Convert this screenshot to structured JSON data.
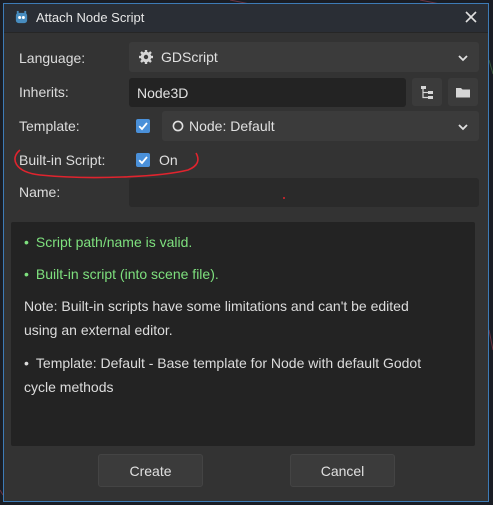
{
  "window": {
    "title": "Attach Node Script"
  },
  "form": {
    "language_label": "Language:",
    "language_value": "GDScript",
    "inherits_label": "Inherits:",
    "inherits_value": "Node3D",
    "template_label": "Template:",
    "template_value": "Node: Default",
    "builtin_label": "Built-in Script:",
    "builtin_value": "On",
    "name_label": "Name:",
    "name_value": ""
  },
  "info": {
    "line1": "Script path/name is valid.",
    "line2": "Built-in script (into scene file).",
    "note_line1": "Note: Built-in scripts have some limitations and can't be edited",
    "note_line2": "using an external editor.",
    "template_line1": "Template: Default - Base template for Node with default Godot",
    "template_line2": "cycle methods",
    "bullet": "•"
  },
  "buttons": {
    "create": "Create",
    "cancel": "Cancel"
  },
  "colors": {
    "accent": "#4a90d9",
    "ok_text": "#7ee07e",
    "annotation": "#e0242e"
  },
  "icons": {
    "title": "godot-icon",
    "close": "close-icon",
    "language": "gear-icon",
    "chevron": "chevron-down-icon",
    "tree": "class-tree-icon",
    "folder": "folder-icon",
    "template": "circle-icon",
    "check": "checkmark-icon"
  }
}
